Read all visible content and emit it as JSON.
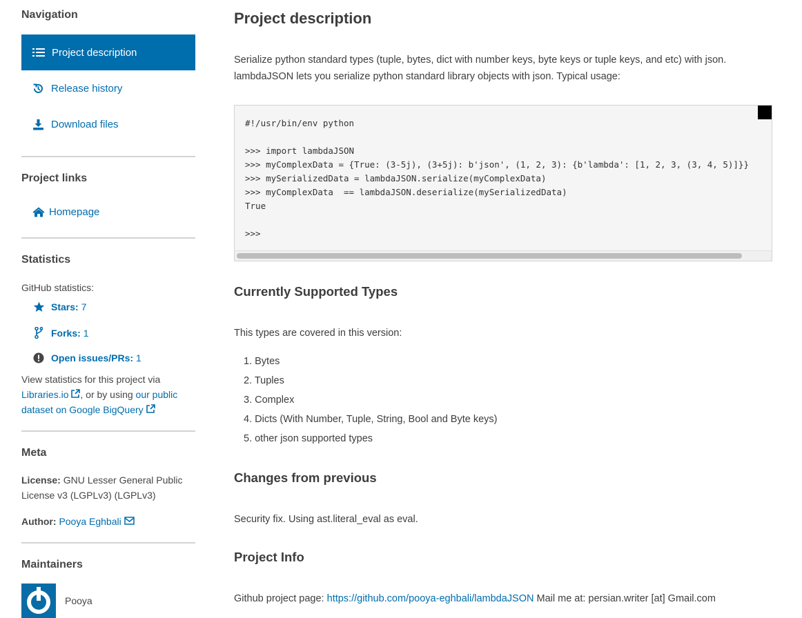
{
  "sidebar": {
    "navigation": {
      "heading": "Navigation",
      "items": [
        {
          "label": "Project description",
          "icon": "list-icon",
          "active": true
        },
        {
          "label": "Release history",
          "icon": "history-icon"
        },
        {
          "label": "Download files",
          "icon": "download-icon"
        }
      ]
    },
    "project_links": {
      "heading": "Project links",
      "homepage": "Homepage"
    },
    "statistics": {
      "heading": "Statistics",
      "github_label": "GitHub statistics:",
      "stars_label": "Stars:",
      "stars_value": "7",
      "forks_label": "Forks:",
      "forks_value": "1",
      "issues_label": "Open issues/PRs:",
      "issues_value": "1",
      "view_text_1": "View statistics for this project via",
      "libraries_link": "Libraries.io",
      "view_text_2": ", or by using ",
      "bigquery_link_1": "our public",
      "bigquery_link_2": "dataset on Google BigQuery"
    },
    "meta": {
      "heading": "Meta",
      "license_label": "License:",
      "license_value_1": "GNU Lesser General Public",
      "license_value_2": "License v3 (LGPLv3) (LGPLv3)",
      "author_label": "Author:",
      "author_name": "Pooya Eghbali"
    },
    "maintainers": {
      "heading": "Maintainers",
      "name": "Pooya"
    }
  },
  "main": {
    "title": "Project description",
    "intro_1": "Serialize python standard types (tuple, bytes, dict with number keys, byte keys or tuple keys, and etc) with json.",
    "intro_2": "lambdaJSON lets you serialize python standard library objects with json. Typical usage:",
    "code": "#!/usr/bin/env python\n\n>>> import lambdaJSON\n>>> myComplexData = {True: (3-5j), (3+5j): b'json', (1, 2, 3): {b'lambda': [1, 2, 3, (3, 4, 5)]}}\n>>> mySerializedData = lambdaJSON.serialize(myComplexData)\n>>> myComplexData  == lambdaJSON.deserialize(mySerializedData)\nTrue\n\n>>>",
    "types_heading": "Currently Supported Types",
    "types_intro": "This types are covered in this version:",
    "types": [
      "1. Bytes",
      "2. Tuples",
      "3. Complex",
      "4. Dicts (With Number, Tuple, String, Bool and Byte keys)",
      "5. other json supported types"
    ],
    "changes_heading": "Changes from previous",
    "changes_text": "Security fix. Using ast.literal_eval as eval.",
    "info_heading": "Project Info",
    "info_prefix": "Github project page: ",
    "info_link": "https://github.com/pooya-eghbali/lambdaJSON",
    "info_suffix": " Mail me at: persian.writer [at] Gmail.com"
  }
}
